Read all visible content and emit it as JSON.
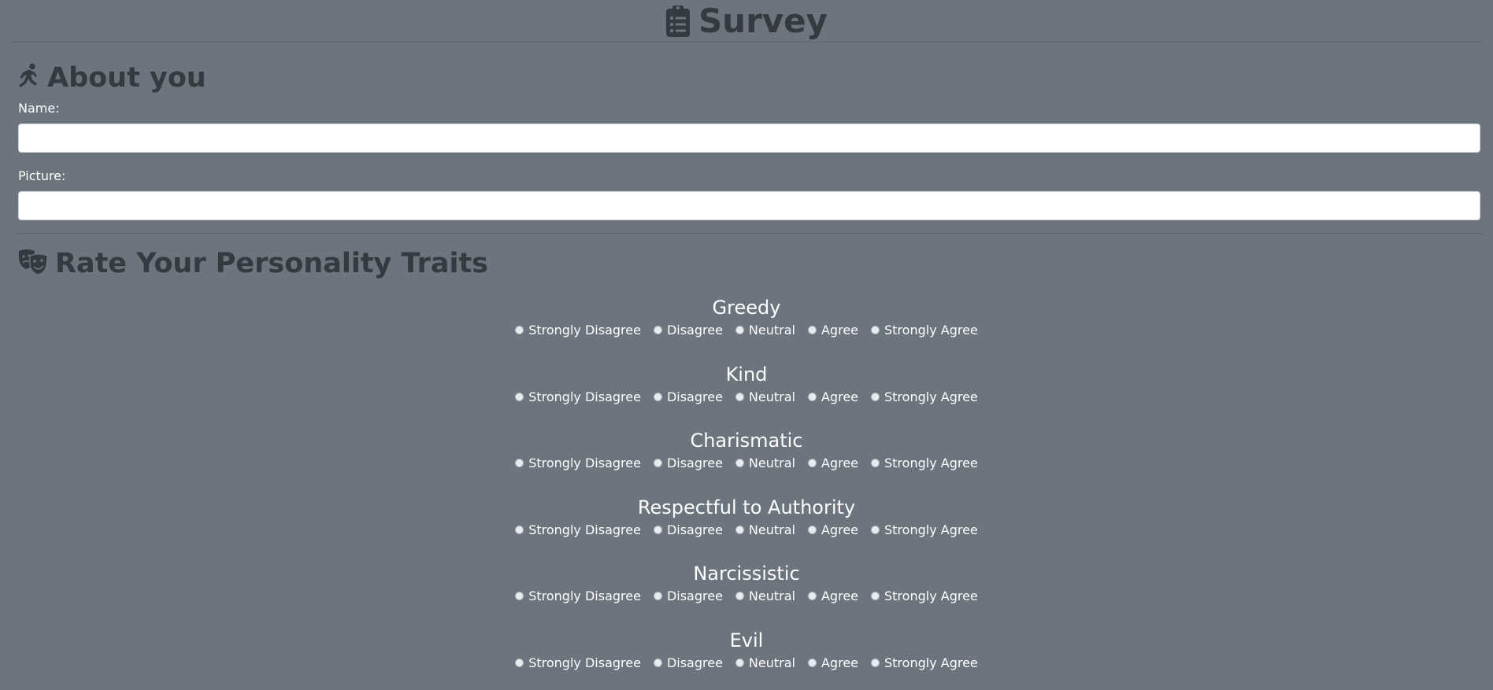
{
  "header": {
    "title": "Survey",
    "icon": "clipboard-list-icon"
  },
  "about": {
    "heading": "About you",
    "icon": "running-person-icon",
    "fields": {
      "name_label": "Name:",
      "name_value": "",
      "picture_label": "Picture:",
      "picture_value": ""
    }
  },
  "traits_section": {
    "heading": "Rate Your Personality Traits",
    "icon": "theater-masks-icon",
    "options": [
      "Strongly Disagree",
      "Disagree",
      "Neutral",
      "Agree",
      "Strongly Agree"
    ],
    "traits": [
      "Greedy",
      "Kind",
      "Charismatic",
      "Respectful to Authority",
      "Narcissistic",
      "Evil"
    ]
  },
  "colors": {
    "background": "#6c757d",
    "heading": "#343a40",
    "text": "#ffffff"
  }
}
